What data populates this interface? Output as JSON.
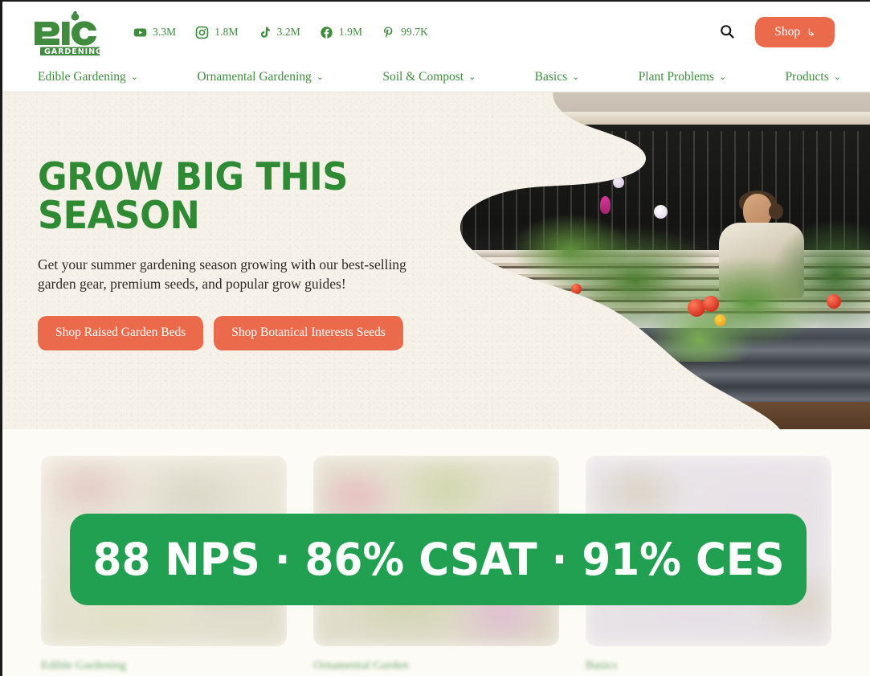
{
  "site": {
    "brand_name": "epic",
    "brand_sub": "GARDENING",
    "green": "#3f8c3f",
    "coral": "#ec6a4c",
    "banner_green": "#22a052"
  },
  "header": {
    "socials": [
      {
        "icon": "youtube-icon",
        "count": "3.3M"
      },
      {
        "icon": "instagram-icon",
        "count": "1.8M"
      },
      {
        "icon": "tiktok-icon",
        "count": "3.2M"
      },
      {
        "icon": "facebook-icon",
        "count": "1.9M"
      },
      {
        "icon": "pinterest-icon",
        "count": "99.7K"
      }
    ],
    "search_icon": "search-icon",
    "shop_label": "Shop",
    "shop_external_glyph": "↳"
  },
  "nav": {
    "items": [
      {
        "label": "Edible Gardening",
        "chevron": "⌄"
      },
      {
        "label": "Ornamental Gardening",
        "chevron": "⌄"
      },
      {
        "label": "Soil & Compost",
        "chevron": "⌄"
      },
      {
        "label": "Basics",
        "chevron": "⌄"
      },
      {
        "label": "Plant Problems",
        "chevron": "⌄"
      },
      {
        "label": "Products",
        "chevron": "⌄"
      }
    ]
  },
  "hero": {
    "title": "Grow Big This Season",
    "subtitle": "Get your summer gardening season growing with our best-selling garden gear, premium seeds, and popular grow guides!",
    "cta_primary": "Shop Raised Garden Beds",
    "cta_secondary": "Shop Botanical Interests Seeds",
    "image_alt": "woman gardening at a raised metal garden bed with tomato plants and a wicker basket"
  },
  "cards": [
    {
      "caption": "Edible Gardening",
      "image_alt": "blurred garden photo"
    },
    {
      "caption": "Ornamental Garden",
      "image_alt": "blurred flower photo"
    },
    {
      "caption": "Basics",
      "image_alt": "blurred plant photo"
    }
  ],
  "metric_banner": {
    "text": "88 NPS · 86% CSAT · 91% CES",
    "nps": "88 NPS",
    "csat": "86% CSAT",
    "ces": "91% CES"
  }
}
